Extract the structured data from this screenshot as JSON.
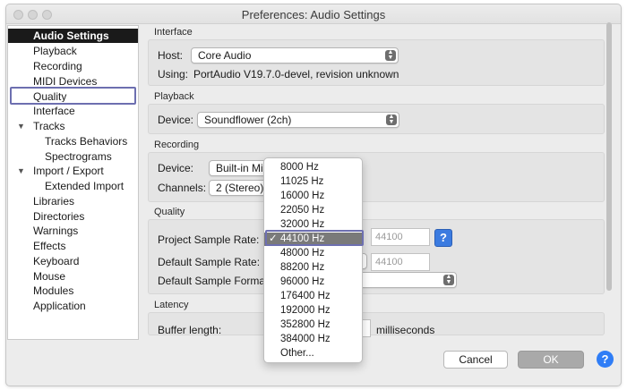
{
  "window": {
    "title": "Preferences: Audio Settings"
  },
  "sidebar": {
    "items": [
      {
        "label": "Audio Settings",
        "selected": true
      },
      {
        "label": "Playback"
      },
      {
        "label": "Recording"
      },
      {
        "label": "MIDI Devices"
      },
      {
        "label": "Quality"
      },
      {
        "label": "Interface"
      },
      {
        "label": "Tracks",
        "expanded": true
      },
      {
        "label": "Tracks Behaviors"
      },
      {
        "label": "Spectrograms"
      },
      {
        "label": "Import / Export",
        "expanded": true
      },
      {
        "label": "Extended Import"
      },
      {
        "label": "Libraries"
      },
      {
        "label": "Directories"
      },
      {
        "label": "Warnings"
      },
      {
        "label": "Effects"
      },
      {
        "label": "Keyboard"
      },
      {
        "label": "Mouse"
      },
      {
        "label": "Modules"
      },
      {
        "label": "Application"
      }
    ]
  },
  "interface": {
    "section": "Interface",
    "host_label": "Host:",
    "host_value": "Core Audio",
    "using_label": "Using:",
    "using_value": "PortAudio V19.7.0-devel, revision unknown"
  },
  "playback": {
    "section": "Playback",
    "device_label": "Device:",
    "device_value": "Soundflower (2ch)"
  },
  "recording": {
    "section": "Recording",
    "device_label": "Device:",
    "device_value": "Built-in Mi",
    "channels_label": "Channels:",
    "channels_value": "2 (Stereo)"
  },
  "quality": {
    "section": "Quality",
    "project_rate_label": "Project Sample Rate:",
    "project_rate_field": "44100",
    "default_rate_label": "Default Sample Rate:",
    "default_rate_field": "44100",
    "default_format_label": "Default Sample Format"
  },
  "latency": {
    "section": "Latency",
    "buffer_label": "Buffer length:",
    "buffer_unit": "milliseconds"
  },
  "sample_rate_menu": {
    "selected": "44100 Hz",
    "checkmark": "✓",
    "options": [
      "8000 Hz",
      "11025 Hz",
      "16000 Hz",
      "22050 Hz",
      "32000 Hz",
      "44100 Hz",
      "48000 Hz",
      "88200 Hz",
      "96000 Hz",
      "176400 Hz",
      "192000 Hz",
      "352800 Hz",
      "384000 Hz",
      "Other..."
    ]
  },
  "footer": {
    "cancel_label": "Cancel",
    "ok_label": "OK",
    "help_glyph": "?"
  },
  "icons": {
    "popup_arrows": "chevron-updown-icon",
    "help": "question-mark-icon"
  },
  "colors": {
    "highlight_box": "#6d6fb0",
    "help_blue": "#2f7df6",
    "selected_sidebar": "#1a1a1a"
  }
}
